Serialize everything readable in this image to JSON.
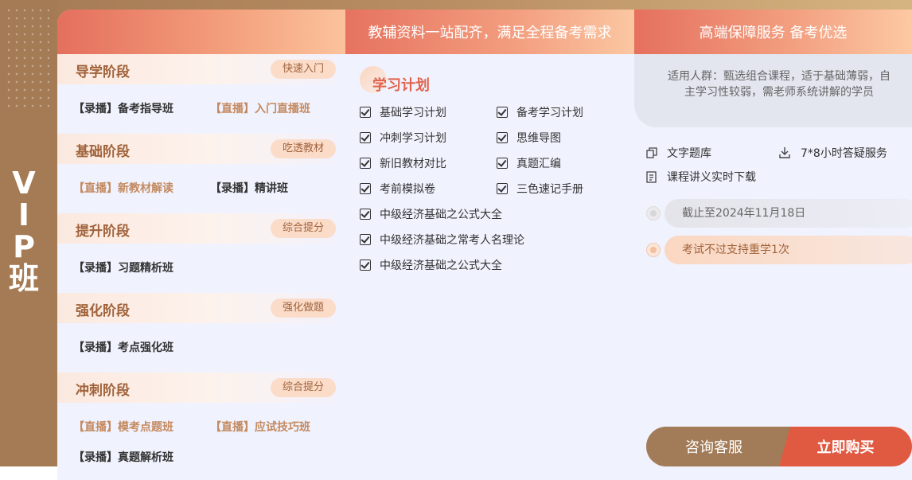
{
  "vip": {
    "chars": [
      "V",
      "I",
      "P",
      "班"
    ]
  },
  "headers": {
    "col2": "教辅资料一站配齐，满足全程备考需求",
    "col3": "高端保障服务 备考优选"
  },
  "stages": [
    {
      "title": "导学阶段",
      "tag": "快速入门",
      "courses": [
        {
          "text": "【录播】备考指导班",
          "kind": "recorded"
        },
        {
          "text": "【直播】入门直播班",
          "kind": "live"
        }
      ]
    },
    {
      "title": "基础阶段",
      "tag": "吃透教材",
      "courses": [
        {
          "text": "【直播】新教材解读",
          "kind": "live"
        },
        {
          "text": "【录播】精讲班",
          "kind": "recorded"
        }
      ]
    },
    {
      "title": "提升阶段",
      "tag": "综合提分",
      "courses": [
        {
          "text": "【录播】习题精析班",
          "kind": "recorded"
        }
      ]
    },
    {
      "title": "强化阶段",
      "tag": "强化做题",
      "courses": [
        {
          "text": "【录播】考点强化班",
          "kind": "recorded"
        }
      ]
    },
    {
      "title": "冲刺阶段",
      "tag": "综合提分",
      "courses": [
        {
          "text": "【直播】模考点题班",
          "kind": "live"
        },
        {
          "text": "【直播】应试技巧班",
          "kind": "live"
        },
        {
          "text": "【录播】真题解析班",
          "kind": "recorded"
        }
      ]
    }
  ],
  "plan": {
    "title": "学习计划",
    "items": [
      "基础学习计划",
      "备考学习计划",
      "冲刺学习计划",
      "思维导图",
      "新旧教材对比",
      "真题汇编",
      "考前模拟卷",
      "三色速记手册",
      "中级经济基础之公式大全",
      "中级经济基础之常考人名理论",
      "中级经济基础之公式大全"
    ]
  },
  "service": {
    "audience": "适用人群：甄选组合课程，适于基础薄弱，自主学习性较弱，需老师系统讲解的学员",
    "features": [
      "文字题库",
      "7*8小时答疑服务",
      "课程讲义实时下载"
    ],
    "deadline": "截止至2024年11月18日",
    "guarantee": "考试不过支持重学1次"
  },
  "buttons": {
    "consult": "咨询客服",
    "buy": "立即购买"
  },
  "colors": {
    "brand_brown": "#a57b55",
    "accent_red": "#e05a42",
    "card_bg": "#f0f2fd"
  }
}
